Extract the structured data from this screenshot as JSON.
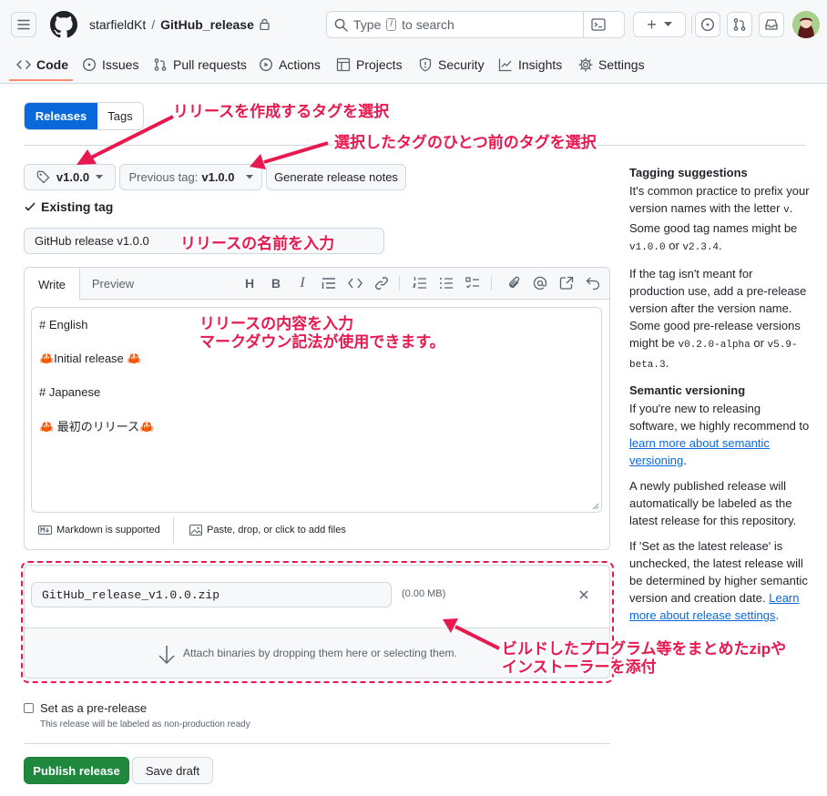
{
  "header": {
    "owner": "starfieldKt",
    "separator": "/",
    "repo": "GitHub_release",
    "search_placeholder_prefix": "Type",
    "search_key": "/",
    "search_placeholder_suffix": "to search",
    "plus_label": "+"
  },
  "nav": {
    "tabs": [
      {
        "label": "Code"
      },
      {
        "label": "Issues"
      },
      {
        "label": "Pull requests"
      },
      {
        "label": "Actions"
      },
      {
        "label": "Projects"
      },
      {
        "label": "Security"
      },
      {
        "label": "Insights"
      },
      {
        "label": "Settings"
      }
    ]
  },
  "toggle": {
    "releases": "Releases",
    "tags": "Tags"
  },
  "tag_select": {
    "tag_value": "v1.0.0",
    "previous_prefix": "Previous tag:",
    "previous_value": "v1.0.0",
    "generate_notes": "Generate release notes",
    "existing_tag": "Existing tag"
  },
  "release_title_value": "GitHub release v1.0.0",
  "editor": {
    "tab_write": "Write",
    "tab_preview": "Preview",
    "lines": [
      "# English",
      "",
      "🦀Initial release 🦀",
      "",
      "# Japanese",
      "",
      "🦀 最初のリリース🦀"
    ],
    "markdown_note": "Markdown is supported",
    "paste_note": "Paste, drop, or click to add files"
  },
  "attachments": {
    "file_name": "GitHub_release_v1.0.0.zip",
    "file_size": "(0.00 MB)",
    "drop_text": "Attach binaries by dropping them here or selecting them."
  },
  "prerelease": {
    "label": "Set as a pre-release",
    "hint": "This release will be labeled as non-production ready"
  },
  "actions": {
    "publish": "Publish release",
    "save_draft": "Save draft"
  },
  "sidebar": {
    "h1": "Tagging suggestions",
    "p1a": "It's common practice to prefix your version names with the letter",
    "p1_v": "v",
    "p1b": ". Some good tag names might be",
    "p1_code1": "v1.0.0",
    "p1_or": "or",
    "p1_code2": "v2.3.4",
    "p1_end": ".",
    "p2a": "If the tag isn't meant for production use, add a pre-release version after the version name. Some good pre-release versions might be",
    "p2_code1": "v0.2.0-alpha",
    "p2_or": "or",
    "p2_code2": "v5.9-beta.3",
    "p2_end": ".",
    "h2": "Semantic versioning",
    "p3a": "If you're new to releasing software, we highly recommend to",
    "p3_link": "learn more about semantic versioning",
    "p3_end": ".",
    "p4": "A newly published release will automatically be labeled as the latest release for this repository.",
    "p5a": "If 'Set as the latest release' is unchecked, the latest release will be determined by higher semantic version and creation date.",
    "p5_link": "Learn more about release settings",
    "p5_end": "."
  },
  "annotations": {
    "a1": "リリースを作成するタグを選択",
    "a2": "選択したタグのひとつ前のタグを選択",
    "a3": "リリースの名前を入力",
    "a4_line1": "リリースの内容を入力",
    "a4_line2": "マークダウン記法が使用できます。",
    "a5_line1": "ビルドしたプログラム等をまとめたzipや",
    "a5_line2": "インストーラーを添付"
  },
  "colors": {
    "accent": "#0969da",
    "publish": "#1f883d",
    "annotation": "#e8194f"
  }
}
